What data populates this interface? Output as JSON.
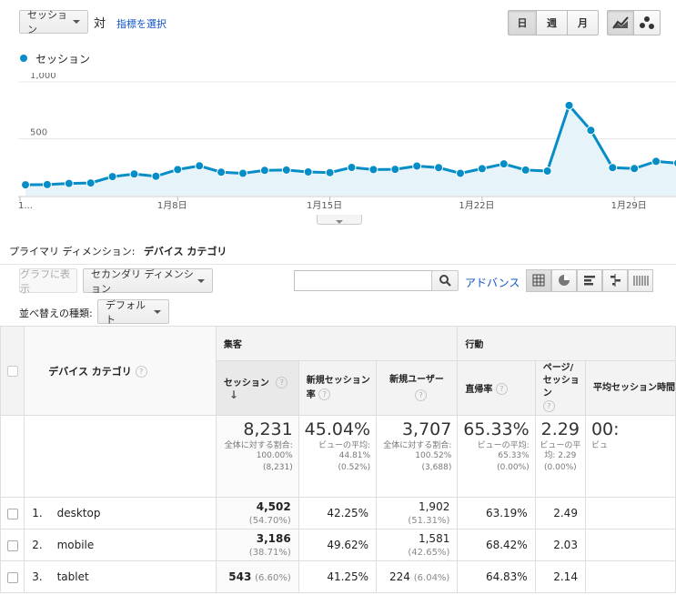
{
  "toolbar": {
    "metric_select": "セッション",
    "vs": "対",
    "select_metric_link": "指標を選択",
    "periods": [
      "日",
      "週",
      "月"
    ],
    "active_period": "日"
  },
  "legend": {
    "label": "セッション",
    "color": "#058dc7"
  },
  "chart_data": {
    "type": "area",
    "title": "",
    "series": [
      {
        "name": "セッション",
        "values": [
          95,
          97,
          107,
          111,
          167,
          190,
          170,
          229,
          262,
          206,
          196,
          222,
          225,
          208,
          202,
          248,
          229,
          231,
          260,
          246,
          196,
          237,
          279,
          225,
          216,
          793,
          574,
          246,
          238,
          301,
          285
        ]
      }
    ],
    "x_tick_labels": [
      "1...",
      "1月8日",
      "1月15日",
      "1月22日",
      "1月29日"
    ],
    "y_tick_labels": [
      "1,000",
      "500"
    ],
    "ylim": [
      0,
      1000
    ],
    "color": "#058dc7",
    "fill": "#e6f3f9"
  },
  "dimension": {
    "label": "プライマリ ディメンション:",
    "value": "デバイス カテゴリ"
  },
  "controls": {
    "plot_rows": "グラフに表示",
    "secondary_dimension": "セカンダリ ディメンション",
    "search_placeholder": "",
    "advanced": "アドバンス",
    "sort_label": "並べ替えの種類:",
    "sort_value": "デフォルト"
  },
  "table": {
    "group_acquisition": "集客",
    "group_behavior": "行動",
    "dimension_header": "デバイス カテゴリ",
    "col_sessions": "セッション",
    "col_new_session_rate": "新規セッション率",
    "col_new_users": "新規ユーザー",
    "col_bounce": "直帰率",
    "col_pages_per_session": "ページ/セッション",
    "col_avg_time": "平均セッション時間",
    "totals": {
      "sessions": "8,231",
      "sessions_sub1": "全体に対する割合: 100.00%",
      "sessions_sub2": "(8,231)",
      "new_session_rate": "45.04%",
      "new_session_rate_sub1": "ビューの平均: 44.81%",
      "new_session_rate_sub2": "(0.52%)",
      "new_users": "3,707",
      "new_users_sub1": "全体に対する割合: 100.52%",
      "new_users_sub2": "(3,688)",
      "bounce": "65.33%",
      "bounce_sub1": "ビューの平均: 65.33%",
      "bounce_sub2": "(0.00%)",
      "pages": "2.29",
      "pages_sub1": "ビューの平均: 2.29",
      "pages_sub2": "(0.00%)",
      "avg_time": "00:",
      "avg_time_sub": "ビュ"
    },
    "rows": [
      {
        "idx": "1.",
        "name": "desktop",
        "sessions": "4,502",
        "sessions_pct": "(54.70%)",
        "nsr": "42.25%",
        "new_users": "1,902",
        "new_users_pct": "(51.31%)",
        "bounce": "63.19%",
        "pages": "2.49"
      },
      {
        "idx": "2.",
        "name": "mobile",
        "sessions": "3,186",
        "sessions_pct": "(38.71%)",
        "nsr": "49.62%",
        "new_users": "1,581",
        "new_users_pct": "(42.65%)",
        "bounce": "68.42%",
        "pages": "2.03"
      },
      {
        "idx": "3.",
        "name": "tablet",
        "sessions": "543",
        "sessions_pct": "(6.60%)",
        "nsr": "41.25%",
        "new_users": "224",
        "new_users_pct": "(6.04%)",
        "bounce": "64.83%",
        "pages": "2.14"
      }
    ]
  }
}
